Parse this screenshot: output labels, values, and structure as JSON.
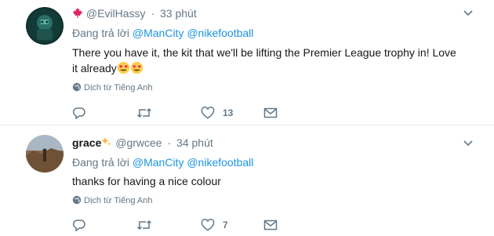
{
  "tweets": [
    {
      "name_prefix_icon": "maple-leaf-icon",
      "name": "",
      "handle": "@EvilHassy",
      "separator": "·",
      "time": "33 phút",
      "reply_prefix": "Đang trả lời",
      "reply_to_1": "@ManCity",
      "reply_to_2": "@nikefootball",
      "text": "There you have it, the kit that we'll be lifting the Premier League trophy in! Love it already",
      "emoji": [
        "heart-eyes-emoji",
        "heart-eyes-emoji"
      ],
      "translate": "Dịch từ Tiếng Anh",
      "reply_count": "",
      "retweet_count": "",
      "like_count": "13"
    },
    {
      "name": "grace",
      "name_suffix_icon": "sparkles-emoji",
      "handle": "@grwcee",
      "separator": "·",
      "time": "34 phút",
      "reply_prefix": "Đang trả lời",
      "reply_to_1": "@ManCity",
      "reply_to_2": "@nikefootball",
      "text": "thanks for having a nice colour",
      "translate": "Dịch từ Tiếng Anh",
      "reply_count": "",
      "retweet_count": "",
      "like_count": "7"
    }
  ],
  "colors": {
    "link": "#1b95e0",
    "muted": "#657786",
    "text": "#14171a",
    "divider": "#e6ecf0",
    "maple": "#e0245e"
  }
}
